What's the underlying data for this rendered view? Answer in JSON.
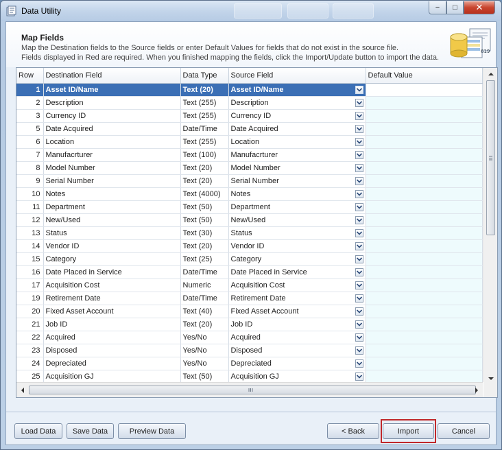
{
  "window": {
    "title": "Data Utility",
    "minimize_label": "−",
    "maximize_label": "□",
    "close_label": "✕"
  },
  "header": {
    "title": "Map Fields",
    "line1": "Map the Destination fields to the Source fields or enter Default Values for fields that do not exist in the source file.",
    "line2": "Fields displayed in Red are required.  When you finished mapping the fields, click the Import/Update button to import the data.",
    "icon_text": "619"
  },
  "grid": {
    "columns": [
      "Row",
      "Destination Field",
      "Data Type",
      "Source Field",
      "Default Value"
    ],
    "selected_row": 1,
    "rows": [
      {
        "row": "1",
        "dest": "Asset ID/Name",
        "type": "Text (20)",
        "source": "Asset ID/Name",
        "default": ""
      },
      {
        "row": "2",
        "dest": "Description",
        "type": "Text (255)",
        "source": "Description",
        "default": ""
      },
      {
        "row": "3",
        "dest": "Currency ID",
        "type": "Text (255)",
        "source": "Currency ID",
        "default": ""
      },
      {
        "row": "5",
        "dest": "Date Acquired",
        "type": "Date/Time",
        "source": "Date Acquired",
        "default": ""
      },
      {
        "row": "6",
        "dest": "Location",
        "type": "Text (255)",
        "source": "Location",
        "default": ""
      },
      {
        "row": "7",
        "dest": "Manufacrturer",
        "type": "Text (100)",
        "source": "Manufacrturer",
        "default": ""
      },
      {
        "row": "8",
        "dest": "Model Number",
        "type": "Text (20)",
        "source": "Model Number",
        "default": ""
      },
      {
        "row": "9",
        "dest": "Serial Number",
        "type": "Text (20)",
        "source": "Serial Number",
        "default": ""
      },
      {
        "row": "10",
        "dest": "Notes",
        "type": "Text (4000)",
        "source": "Notes",
        "default": ""
      },
      {
        "row": "11",
        "dest": "Department",
        "type": "Text (50)",
        "source": "Department",
        "default": ""
      },
      {
        "row": "12",
        "dest": "New/Used",
        "type": "Text (50)",
        "source": "New/Used",
        "default": ""
      },
      {
        "row": "13",
        "dest": "Status",
        "type": "Text (30)",
        "source": "Status",
        "default": ""
      },
      {
        "row": "14",
        "dest": "Vendor ID",
        "type": "Text (20)",
        "source": "Vendor ID",
        "default": ""
      },
      {
        "row": "15",
        "dest": "Category",
        "type": "Text (25)",
        "source": "Category",
        "default": ""
      },
      {
        "row": "16",
        "dest": "Date Placed in Service",
        "type": "Date/Time",
        "source": "Date Placed in Service",
        "default": ""
      },
      {
        "row": "17",
        "dest": "Acquisition Cost",
        "type": "Numeric",
        "source": "Acquisition Cost",
        "default": ""
      },
      {
        "row": "19",
        "dest": "Retirement Date",
        "type": "Date/Time",
        "source": "Retirement Date",
        "default": ""
      },
      {
        "row": "20",
        "dest": "Fixed Asset Account",
        "type": "Text (40)",
        "source": "Fixed Asset Account",
        "default": ""
      },
      {
        "row": "21",
        "dest": "Job ID",
        "type": "Text (20)",
        "source": "Job ID",
        "default": ""
      },
      {
        "row": "22",
        "dest": "Acquired",
        "type": "Yes/No",
        "source": "Acquired",
        "default": ""
      },
      {
        "row": "23",
        "dest": "Disposed",
        "type": "Yes/No",
        "source": "Disposed",
        "default": ""
      },
      {
        "row": "24",
        "dest": "Depreciated",
        "type": "Yes/No",
        "source": "Depreciated",
        "default": ""
      },
      {
        "row": "25",
        "dest": "Acquisition GJ",
        "type": "Text (50)",
        "source": "Acquisition GJ",
        "default": ""
      }
    ]
  },
  "footer": {
    "load_label": "Load Data",
    "save_label": "Save Data",
    "preview_label": "Preview Data",
    "back_label": "< Back",
    "import_label": "Import",
    "cancel_label": "Cancel"
  },
  "colors": {
    "selection": "#3b6fb5",
    "highlight_border": "#c0282a",
    "default_value_bg": "#eefbfd"
  }
}
